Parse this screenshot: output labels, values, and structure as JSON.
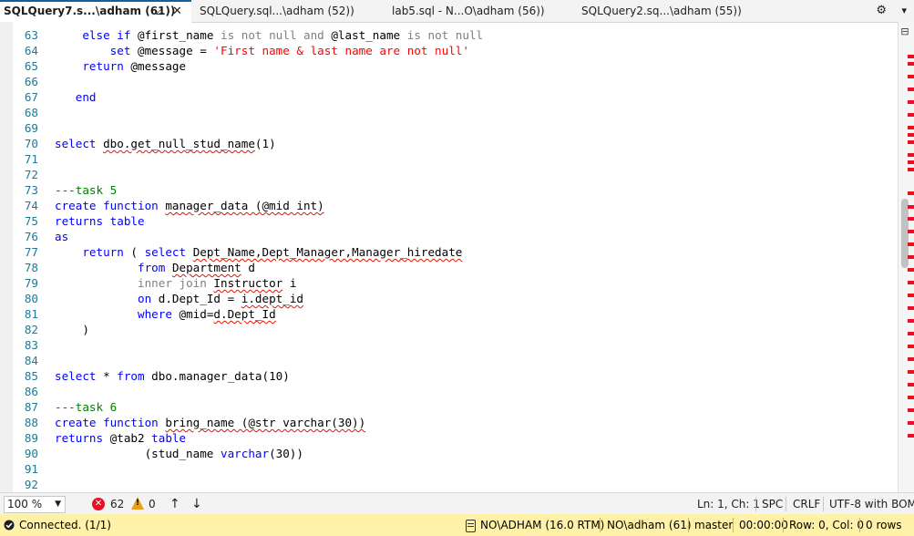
{
  "tabs": [
    {
      "label": "SQLQuery7.s...\\adham (61))",
      "active": true
    },
    {
      "label": "SQLQuery.sql...\\adham (52))",
      "active": false
    },
    {
      "label": "lab5.sql - N...O\\adham (56))",
      "active": false
    },
    {
      "label": "SQLQuery2.sq...\\adham (55))",
      "active": false
    }
  ],
  "tab_icons": {
    "pin": "pin-icon",
    "close": "close-icon",
    "settings": "gear-icon",
    "menu": "chevron-down-icon"
  },
  "editor": {
    "lines": [
      {
        "n": "63",
        "segs": [
          {
            "t": "    "
          },
          {
            "t": "else if",
            "c": "kw"
          },
          {
            "t": " @first_name "
          },
          {
            "t": "is not null and",
            "c": "gr"
          },
          {
            "t": " @last_name "
          },
          {
            "t": "is not null",
            "c": "gr"
          }
        ]
      },
      {
        "n": "64",
        "segs": [
          {
            "t": "        "
          },
          {
            "t": "set",
            "c": "kw"
          },
          {
            "t": " @message = "
          },
          {
            "t": "'First name & last name are not null'",
            "c": "str"
          }
        ]
      },
      {
        "n": "65",
        "segs": [
          {
            "t": "    "
          },
          {
            "t": "return",
            "c": "kw"
          },
          {
            "t": " @message"
          }
        ]
      },
      {
        "n": "66",
        "segs": []
      },
      {
        "n": "67",
        "segs": [
          {
            "t": "   "
          },
          {
            "t": "end",
            "c": "kw"
          }
        ]
      },
      {
        "n": "68",
        "segs": []
      },
      {
        "n": "69",
        "segs": []
      },
      {
        "n": "70",
        "segs": [
          {
            "t": "select",
            "c": "kw"
          },
          {
            "t": " "
          },
          {
            "t": "dbo.get_null_stud_name",
            "s": true
          },
          {
            "t": "(1)"
          }
        ]
      },
      {
        "n": "71",
        "segs": []
      },
      {
        "n": "72",
        "segs": []
      },
      {
        "n": "73",
        "segs": [
          {
            "t": "---task 5",
            "c": "cm"
          }
        ]
      },
      {
        "n": "74",
        "segs": [
          {
            "t": "create function",
            "c": "kw"
          },
          {
            "t": " "
          },
          {
            "t": "manager_data (@mid int)",
            "s": true
          }
        ]
      },
      {
        "n": "75",
        "segs": [
          {
            "t": "returns table",
            "c": "kw"
          }
        ]
      },
      {
        "n": "76",
        "segs": [
          {
            "t": "as",
            "c": "kw"
          }
        ]
      },
      {
        "n": "77",
        "segs": [
          {
            "t": "    "
          },
          {
            "t": "return",
            "c": "kw"
          },
          {
            "t": " ( "
          },
          {
            "t": "select",
            "c": "kw"
          },
          {
            "t": " "
          },
          {
            "t": "Dept_Name,Dept_Manager,Manager_hiredate",
            "s": true
          }
        ]
      },
      {
        "n": "78",
        "segs": [
          {
            "t": "            "
          },
          {
            "t": "from",
            "c": "kw"
          },
          {
            "t": " "
          },
          {
            "t": "Department",
            "s": true
          },
          {
            "t": " d"
          }
        ]
      },
      {
        "n": "79",
        "segs": [
          {
            "t": "            "
          },
          {
            "t": "inner join",
            "c": "gr"
          },
          {
            "t": " "
          },
          {
            "t": "Instructor",
            "s": true
          },
          {
            "t": " i"
          }
        ]
      },
      {
        "n": "80",
        "segs": [
          {
            "t": "            "
          },
          {
            "t": "on",
            "c": "kw"
          },
          {
            "t": " d.Dept_Id = "
          },
          {
            "t": "i.dept_id",
            "s": true
          }
        ]
      },
      {
        "n": "81",
        "segs": [
          {
            "t": "            "
          },
          {
            "t": "where",
            "c": "kw"
          },
          {
            "t": " @mid="
          },
          {
            "t": "d.Dept_Id",
            "s": true
          }
        ]
      },
      {
        "n": "82",
        "segs": [
          {
            "t": "    )"
          }
        ]
      },
      {
        "n": "83",
        "segs": []
      },
      {
        "n": "84",
        "segs": []
      },
      {
        "n": "85",
        "segs": [
          {
            "t": "select",
            "c": "kw"
          },
          {
            "t": " * "
          },
          {
            "t": "from",
            "c": "kw"
          },
          {
            "t": " dbo.manager_data(10)"
          }
        ]
      },
      {
        "n": "86",
        "segs": []
      },
      {
        "n": "87",
        "segs": [
          {
            "t": "---task 6",
            "c": "cm"
          }
        ]
      },
      {
        "n": "88",
        "segs": [
          {
            "t": "create function",
            "c": "kw"
          },
          {
            "t": " "
          },
          {
            "t": "bring_name (@str varchar(30))",
            "s": true
          }
        ]
      },
      {
        "n": "89",
        "segs": [
          {
            "t": "returns",
            "c": "kw"
          },
          {
            "t": " @tab2 "
          },
          {
            "t": "table",
            "c": "kw"
          }
        ]
      },
      {
        "n": "90",
        "segs": [
          {
            "t": "             (stud_name "
          },
          {
            "t": "varchar",
            "c": "kw"
          },
          {
            "t": "(30))"
          }
        ]
      },
      {
        "n": "91",
        "segs": []
      },
      {
        "n": "92",
        "segs": []
      }
    ]
  },
  "status": {
    "zoom": "100 %",
    "errors": "62",
    "warnings": "0",
    "position": "Ln: 1, Ch: 1",
    "spc": "SPC",
    "eol": "CRLF",
    "encoding": "UTF-8 with BOM"
  },
  "connection": {
    "status": "Connected. (1/1)",
    "server": "NO\\ADHAM (16.0 RTM)",
    "user": "NO\\adham (61)",
    "database": "master",
    "time": "00:00:00",
    "rowcol": "Row: 0, Col: 0",
    "rows": "0 rows"
  },
  "colors": {
    "accent": "#0e639c",
    "keyword": "#0000ff",
    "string": "#ff0000",
    "comment": "#008000",
    "error": "#e81123",
    "connbar": "#fff2a8"
  }
}
